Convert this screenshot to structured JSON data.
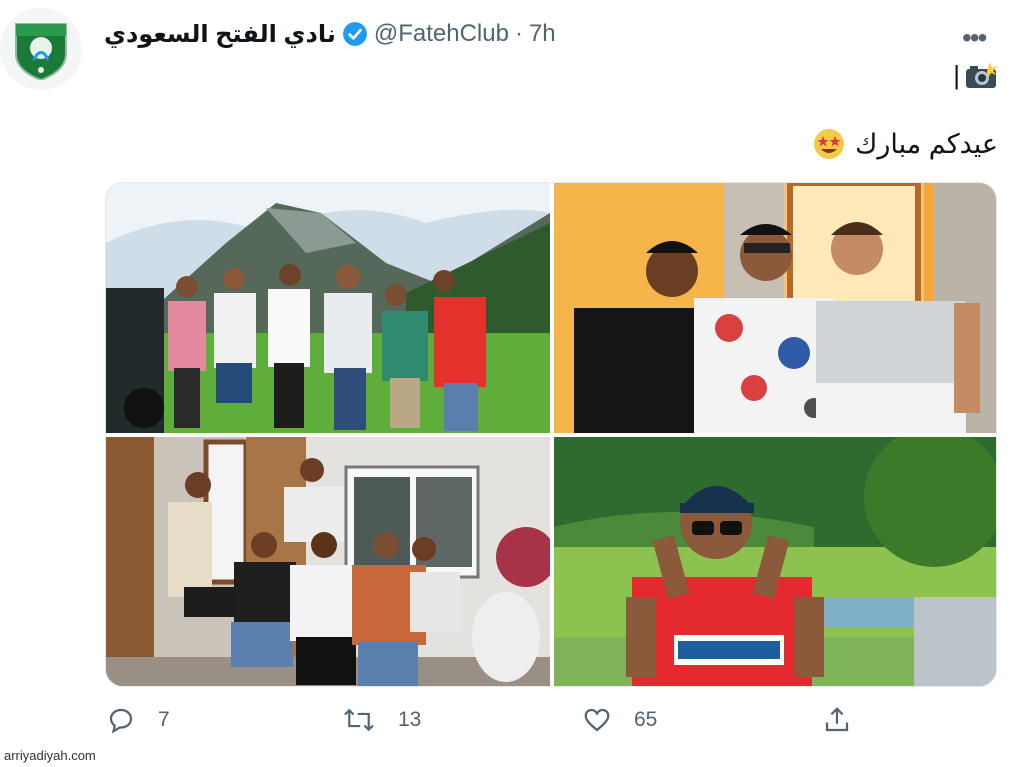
{
  "tweet": {
    "display_name": "نادي الفتح السعودي",
    "handle": "@FatehClub",
    "separator": "·",
    "time": "7h",
    "line1_text": "|",
    "line2_text": "عيدكم مبارك",
    "avatar_alt": "Fateh club logo",
    "icons": {
      "verified": "verified-badge-icon",
      "more": "more-options-icon",
      "camera": "camera-flash-emoji",
      "emoji": "star-struck-emoji"
    },
    "photos": [
      {
        "name": "photo-mountain-group"
      },
      {
        "name": "photo-three-players"
      },
      {
        "name": "photo-house-group"
      },
      {
        "name": "photo-player-cap"
      }
    ],
    "actions": {
      "reply_count": "7",
      "retweet_count": "13",
      "like_count": "65"
    }
  },
  "colors": {
    "verified_blue": "#1d9bf0",
    "secondary_text": "#536471",
    "primary_text": "#0f1419"
  },
  "watermark": "arriyadiyah.com"
}
